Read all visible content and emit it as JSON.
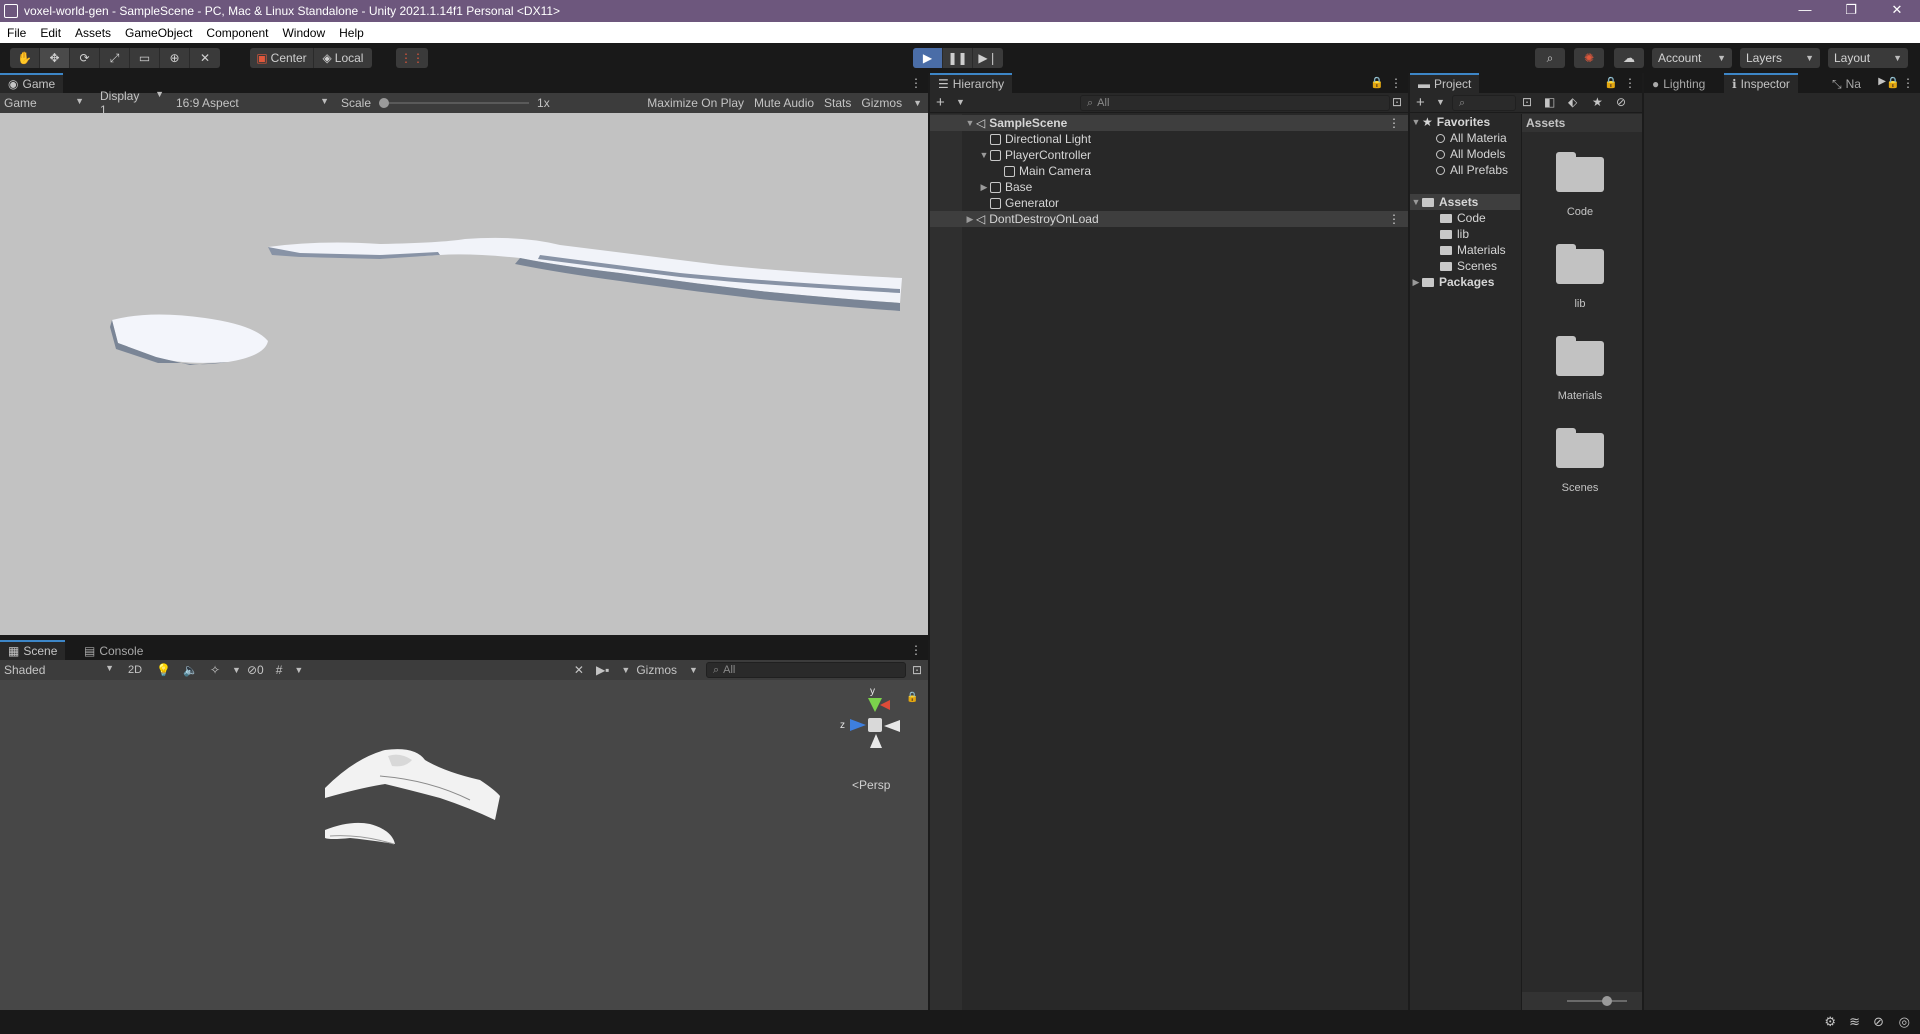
{
  "window": {
    "title": "voxel-world-gen - SampleScene - PC, Mac & Linux Standalone - Unity 2021.1.14f1 Personal <DX11>",
    "controls": [
      "—",
      "❐",
      "✕"
    ]
  },
  "menu": [
    "File",
    "Edit",
    "Assets",
    "GameObject",
    "Component",
    "Window",
    "Help"
  ],
  "toolbar": {
    "tools": [
      "✋",
      "✥",
      "⟳",
      "⤢",
      "▭",
      "⊕",
      "✕"
    ],
    "pivot": "Center",
    "space": "Local",
    "snap": "⋮⋮",
    "playback": [
      "▶",
      "❚❚",
      "▶❘"
    ],
    "account": "Account",
    "layers": "Layers",
    "layout": "Layout"
  },
  "game": {
    "tab": "Game",
    "mode": "Game",
    "display": "Display 1",
    "aspect": "16:9 Aspect",
    "scale_label": "Scale",
    "scale_value": "1x",
    "maximize": "Maximize On Play",
    "mute": "Mute Audio",
    "stats": "Stats",
    "gizmos": "Gizmos"
  },
  "scene": {
    "tabs": [
      "Scene",
      "Console"
    ],
    "shading": "Shaded",
    "twod": "2D",
    "hidden_count": "0",
    "gizmos": "Gizmos",
    "search_placeholder": "All",
    "persp": "Persp",
    "axes": {
      "y": "y",
      "z": "z"
    }
  },
  "hierarchy": {
    "tab": "Hierarchy",
    "add": "+",
    "search_placeholder": "All",
    "items": [
      {
        "label": "SampleScene",
        "depth": 0,
        "scene": true,
        "expanded": true
      },
      {
        "label": "Directional Light",
        "depth": 1
      },
      {
        "label": "PlayerController",
        "depth": 1,
        "expanded": true
      },
      {
        "label": "Main Camera",
        "depth": 2
      },
      {
        "label": "Base",
        "depth": 1,
        "collapsed": true
      },
      {
        "label": "Generator",
        "depth": 1
      },
      {
        "label": "DontDestroyOnLoad",
        "depth": 0,
        "scene": true,
        "collapsed": true
      }
    ]
  },
  "project": {
    "tab": "Project",
    "favorites_label": "Favorites",
    "favorites": [
      "All Materia",
      "All Models",
      "All Prefabs"
    ],
    "assets_label": "Assets",
    "asset_folders": [
      "Code",
      "lib",
      "Materials",
      "Scenes"
    ],
    "packages_label": "Packages",
    "grid_header": "Assets",
    "grid_items": [
      "Code",
      "lib",
      "Materials",
      "Scenes"
    ]
  },
  "right_tabs": {
    "lighting": "Lighting",
    "inspector": "Inspector",
    "navigation": "Na"
  }
}
